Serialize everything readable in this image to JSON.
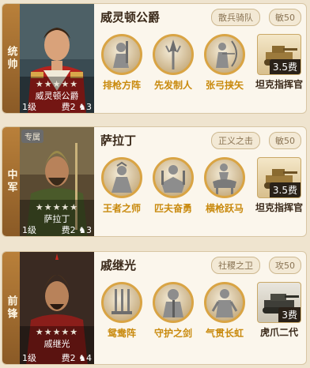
{
  "cards": [
    {
      "side": "统帅",
      "special_tag": "",
      "general_name": "威灵顿公爵",
      "stars": "★★★★★",
      "level": "1级",
      "cost": "费2",
      "horse": "3",
      "army": "散兵骑队",
      "stat": "敏50",
      "skills": [
        {
          "icon": "rifle-soldier-icon",
          "label": "排枪方阵"
        },
        {
          "icon": "spear-tip-icon",
          "label": "先发制人"
        },
        {
          "icon": "archer-icon",
          "label": "张弓挟矢"
        }
      ],
      "tactic": {
        "icon": "tank-icon",
        "fee": "3.5费",
        "label": "坦克指挥官"
      }
    },
    {
      "side": "中军",
      "special_tag": "专属",
      "general_name": "萨拉丁",
      "stars": "★★★★★",
      "level": "1级",
      "cost": "费2",
      "horse": "3",
      "army": "正义之击",
      "stat": "敏50",
      "skills": [
        {
          "icon": "king-teacher-icon",
          "label": "王者之师"
        },
        {
          "icon": "warrior-icon",
          "label": "匹夫奋勇"
        },
        {
          "icon": "horse-rider-icon",
          "label": "横枪跃马"
        }
      ],
      "tactic": {
        "icon": "tank-icon",
        "fee": "3.5费",
        "label": "坦克指挥官"
      }
    },
    {
      "side": "前锋",
      "special_tag": "",
      "general_name": "戚继光",
      "stars": "★★★★★",
      "level": "1级",
      "cost": "费2",
      "horse": "4",
      "army": "社稷之卫",
      "stat": "攻50",
      "skills": [
        {
          "icon": "swords-icon",
          "label": "鸳鸯阵"
        },
        {
          "icon": "sword-guard-icon",
          "label": "守护之剑"
        },
        {
          "icon": "knight-icon",
          "label": "气贯长虹"
        }
      ],
      "tactic": {
        "icon": "tank-icon",
        "fee": "3费",
        "label": "虎爪二代"
      }
    }
  ]
}
